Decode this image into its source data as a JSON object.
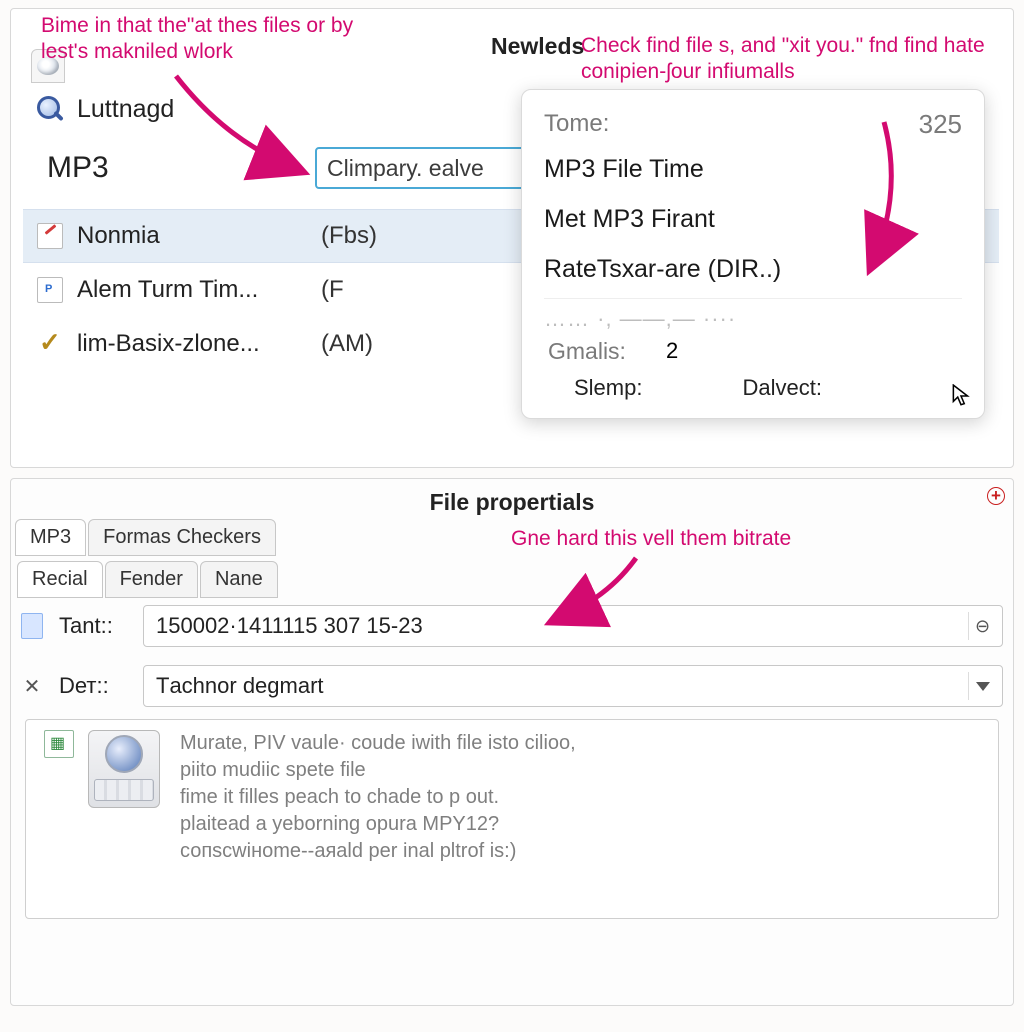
{
  "annotations": {
    "top_left": "Bime in that the\"at thes files or by lest's makniled wlork",
    "top_right": "Check find file s, and \"хit you.\" fnd find hate coniрien-ʃоur infiumalls",
    "new_leds": "Newleds",
    "bottom": "Gne hard this vell them bitrate"
  },
  "top": {
    "search_label": "Luttnagd",
    "heading": "MP3",
    "pill_text": "Climpary. ealve",
    "files": [
      {
        "name": "Nonmia",
        "meta": "(Fbs)",
        "icon": "doc",
        "selected": true
      },
      {
        "name": "Alem Turm Tim...",
        "meta": "(F",
        "icon": "paper",
        "selected": false
      },
      {
        "name": "lim-Basix-zlone...",
        "meta": "(AM)",
        "icon": "check",
        "selected": false
      }
    ]
  },
  "popup": {
    "tome_label": "Tome:",
    "tome_value": "325",
    "items": [
      "MP3 File Time",
      "Met MP3 Firant",
      "RateTsхаr-are (DIR..)"
    ],
    "ghost": "…… ·, ——,— ····",
    "gmalis_label": "Gmalis:",
    "gmalis_value": "2",
    "slemp_label": "Slemр:",
    "slemp_value": "Dalvect:"
  },
  "bottom": {
    "title": "File propertials",
    "tabs_outer": [
      "MP3",
      "Formas Checkers"
    ],
    "tabs_inner": [
      "Reсіal",
      "Fender",
      "Nane"
    ],
    "field1_label": "Tant::",
    "field1_value": "150002·1411115 307 15-23",
    "field2_label": "Dет::",
    "field2_value": "Tаchnor degmart",
    "desc_lines": [
      "Murate, РIV vaulе· coude іwіth filе іsto cilioо,",
      "рiitо mudiіc sреte file",
      "fime it filles реach to chade to р out.",
      "рlaitead a yeborning oрura MPY12?",
      "сопsсwіноmе--аяald per іnal рltrоf is:)"
    ]
  }
}
